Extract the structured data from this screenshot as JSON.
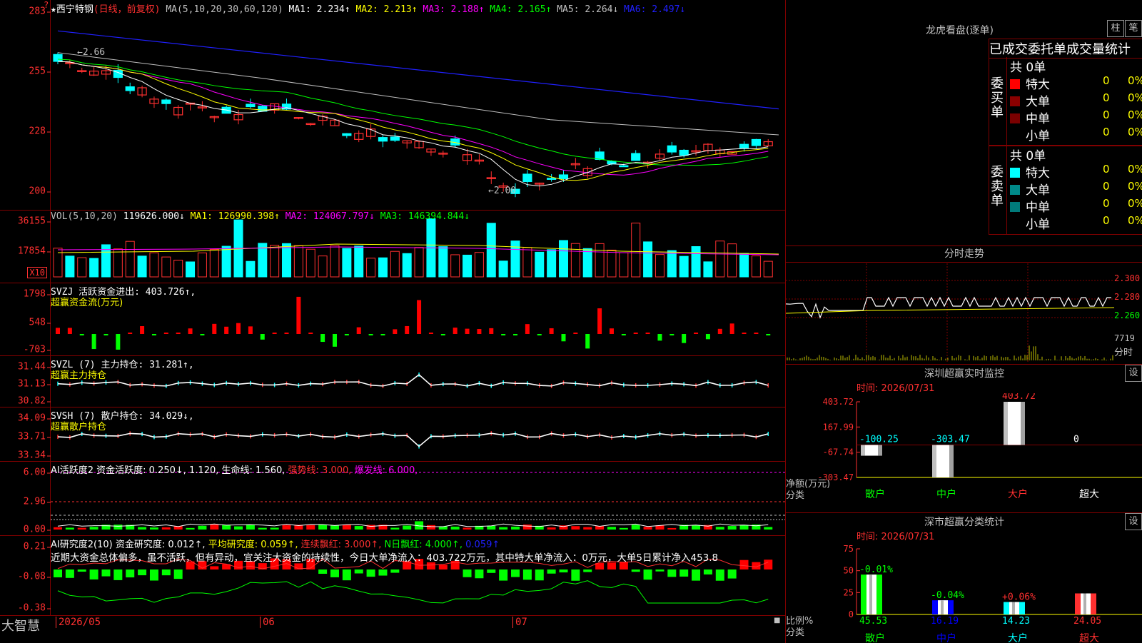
{
  "app": {
    "brand": "大智慧"
  },
  "stock": {
    "name": "西宁特钢",
    "mode": "(日线，前复权)"
  },
  "main": {
    "ma_label": "MA(5,10,20,30,60,120)",
    "ma1": "MA1: 2.234↑",
    "ma2": "MA2: 2.213↑",
    "ma3": "MA3: 2.188↑",
    "ma4": "MA4: 2.165↑",
    "ma5": "MA5: 2.264↓",
    "ma6": "MA6: 2.497↓",
    "y_ticks": [
      "283",
      "255",
      "228",
      "200"
    ],
    "high_label": "←2.66",
    "low_label": "←2.00",
    "colors": {
      "ma1": "#ffffff",
      "ma2": "#ffff00",
      "ma3": "#ff00ff",
      "ma4": "#00ff00",
      "ma5": "#c0c0c0",
      "ma6": "#2020ff",
      "up": "#ff3030",
      "down": "#00ffff"
    }
  },
  "vol": {
    "label": "VOL(5,10,20)",
    "value": "119626.000↓",
    "ma1": "MA1: 126990.398↑",
    "ma2": "MA2: 124067.797↓",
    "ma3": "MA3: 146394.844↓",
    "y_ticks": [
      "36155",
      "17854"
    ],
    "unit": "X10"
  },
  "svzj": {
    "label": "SVZJ 活跃资金进出: 403.726↑,",
    "sub": "超赢资金流(万元)",
    "y_ticks": [
      "1798",
      "548",
      "-703"
    ]
  },
  "svzl": {
    "label": "SVZL (7) 主力持仓: 31.281↑,",
    "sub": "超赢主力持仓",
    "y_ticks": [
      "31.44",
      "31.13",
      "30.82"
    ]
  },
  "svsh": {
    "label": "SVSH (7) 散户持仓: 34.029↓,",
    "sub": "超赢散户持仓",
    "y_ticks": [
      "34.09",
      "33.71",
      "33.34"
    ]
  },
  "ai1": {
    "p1": "AI活跃度2 资金活跃度: 0.250↓,",
    "p2": "1.120,",
    "p3": "生命线: 1.560,",
    "p4": "强势线: 3.000,",
    "p5": "爆发线: 6.000,",
    "y_ticks": [
      "6.00",
      "2.96",
      "0.00"
    ]
  },
  "ai2": {
    "p1": "AI研究度2(10) 资金研究度: 0.012↑,",
    "p2": "平均研究度: 0.059↑,",
    "p3": "连续飘红: 3.000↑,",
    "p4": "N日飘红: 4.000↑,",
    "p5": "0.059↑",
    "comment": "近期大资金总体偏多，虽不活跃，但有异动，宜关注大资金的持续性，今日大单净流入：403.722万元，其中特大单净流入：0万元，大单5日累计净入453.8",
    "y_ticks": [
      "0.21",
      "-0.08",
      "-0.38"
    ]
  },
  "xaxis": {
    "labels": [
      "2026/05",
      "06",
      "07"
    ]
  },
  "dragon": {
    "title": "龙虎看盘(逐单)",
    "btn1": "柱",
    "btn2": "笔",
    "tabs": "已成交委托单成交量统计",
    "buy": {
      "side": "委买单",
      "total": "共 0单",
      "rows": [
        {
          "name": "特大",
          "count": "0",
          "pct": "0%",
          "color": "#ff0000"
        },
        {
          "name": "大单",
          "count": "0",
          "pct": "0%",
          "color": "#8b0000"
        },
        {
          "name": "中单",
          "count": "0",
          "pct": "0%",
          "color": "#7a0000"
        },
        {
          "name": "小单",
          "count": "0",
          "pct": "0%",
          "color": "#000000"
        }
      ]
    },
    "sell": {
      "side": "委卖单",
      "total": "共 0单",
      "rows": [
        {
          "name": "特大",
          "count": "0",
          "pct": "0%",
          "color": "#00ffff"
        },
        {
          "name": "大单",
          "count": "0",
          "pct": "0%",
          "color": "#008b8b"
        },
        {
          "name": "中单",
          "count": "0",
          "pct": "0%",
          "color": "#007a7a"
        },
        {
          "name": "小单",
          "count": "0",
          "pct": "0%",
          "color": "#000000"
        }
      ]
    }
  },
  "intraday": {
    "title": "分时走势",
    "y_ticks": [
      "2.300",
      "2.280",
      "2.260"
    ],
    "vol": "7719",
    "unit": "分时"
  },
  "monitor": {
    "title": "深圳超赢实时监控",
    "btn": "设",
    "time": "时间: 2026/07/31",
    "y_ticks": [
      "403.72",
      "167.99",
      "-67.74",
      "-303.47"
    ],
    "ylabel": "净额(万元)",
    "xlabel": "分类",
    "cats": [
      "散户",
      "中户",
      "大户",
      "超大"
    ],
    "values": [
      -100.25,
      -303.47,
      403.72,
      0
    ],
    "labels": [
      "-100.25",
      "-303.47",
      "403.72",
      "0"
    ]
  },
  "stat": {
    "title": "深市超赢分类统计",
    "btn": "设",
    "time": "时间: 2026/07/31",
    "y_ticks": [
      "75",
      "50",
      "25",
      "0"
    ],
    "ylabel": "比例%",
    "xlabel": "分类",
    "cats": [
      "散户",
      "中户",
      "大户",
      "超大"
    ],
    "values": [
      45.53,
      16.19,
      14.23,
      24.05
    ],
    "top_labels": [
      "-0.01%",
      "-0.04%",
      "+0.06%",
      ""
    ],
    "labels": [
      "45.53",
      "16.19",
      "14.23",
      "24.05"
    ]
  }
}
